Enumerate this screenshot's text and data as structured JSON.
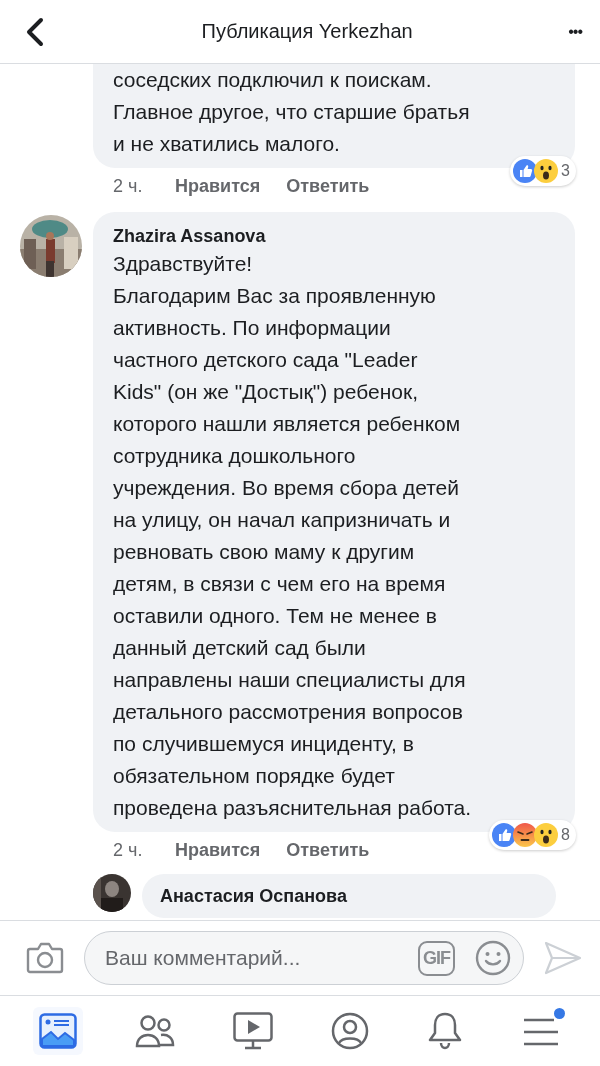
{
  "header": {
    "title": "Публикация Yerkezhan",
    "more": "•••"
  },
  "comments": [
    {
      "text": "соседских подключил к поискам.\nГлавное другое, что старшие братья\nи не хватились малого.",
      "time": "2 ч.",
      "like": "Нравится",
      "reply": "Ответить",
      "reactions": [
        {
          "kind": "like"
        },
        {
          "kind": "wow"
        }
      ],
      "count": "3"
    },
    {
      "author": "Zhazira Assanova",
      "text": "Здравствуйте!\nБлагодарим Вас за проявленную\nактивность. По информации\nчастного детского сада \"Leader\nKids\" (он же \"Достық\") ребенок,\nкоторого нашли является ребенком\nсотрудника дошкольного\nучреждения. Во время сбора детей\nна улицу, он начал капризничать и\nревновать свою маму к другим\nдетям, в связи с чем его на время\nоставили одного. Тем не менее в\nданный детский сад были\nнаправлены наши специалисты для\nдетального рассмотрения вопросов\nпо случившемуся инциденту, в\nобязательном порядке будет\nпроведена разъяснительная работа.",
      "time": "2 ч.",
      "like": "Нравится",
      "reply": "Ответить",
      "reactions": [
        {
          "kind": "like"
        },
        {
          "kind": "angry"
        },
        {
          "kind": "wow"
        }
      ],
      "count": "8"
    }
  ],
  "reply_preview": {
    "author": "Анастасия Оспанова"
  },
  "composer": {
    "placeholder": "Ваш комментарий...",
    "gif": "GIF"
  },
  "nav": [
    {
      "kind": "feed",
      "selected": true,
      "badge": false
    },
    {
      "kind": "friends",
      "selected": false,
      "badge": false
    },
    {
      "kind": "watch",
      "selected": false,
      "badge": false
    },
    {
      "kind": "profile",
      "selected": false,
      "badge": false
    },
    {
      "kind": "bell",
      "selected": false,
      "badge": false
    },
    {
      "kind": "menu",
      "selected": false,
      "badge": true
    }
  ]
}
